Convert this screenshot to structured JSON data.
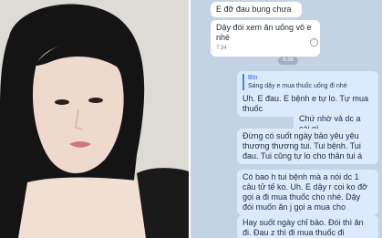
{
  "chat": {
    "messages": [
      {
        "text": "E đỡ đau bụng chưa",
        "time": ""
      },
      {
        "text": "Dậy đói xem ăn uống vô e nhé",
        "time": "7:34"
      },
      {
        "text": "Uh. E đau. E bệnh e tự lo. Tự mua thuốc",
        "time": ""
      },
      {
        "text": "Chứ nhờ vả dc a cái gì",
        "time": ""
      },
      {
        "text": "Đừng có suốt ngày bảo yêu yêu thương thương tui. Tui bệnh. Tui đau. Tui cũng tự lo cho thân tui á",
        "time": ""
      },
      {
        "text": "Có bao h tui bệnh mà a nói dc 1 câu tử tế ko. Uh. E dậy r coi ko đỡ gọi a đi mua thuốc cho nhé. Dậy đói muốn ăn j gọi a mua cho",
        "time": ""
      },
      {
        "text": "Hay suốt ngày chỉ bảo. Đói thì ăn đi. Đau z thì đi mua thuốc đi",
        "time": ""
      }
    ],
    "reply_quote": {
      "name": "Btn",
      "text": "Sáng dậy e mua thuốc uống đi nhé"
    },
    "date_pill": "9:26"
  }
}
